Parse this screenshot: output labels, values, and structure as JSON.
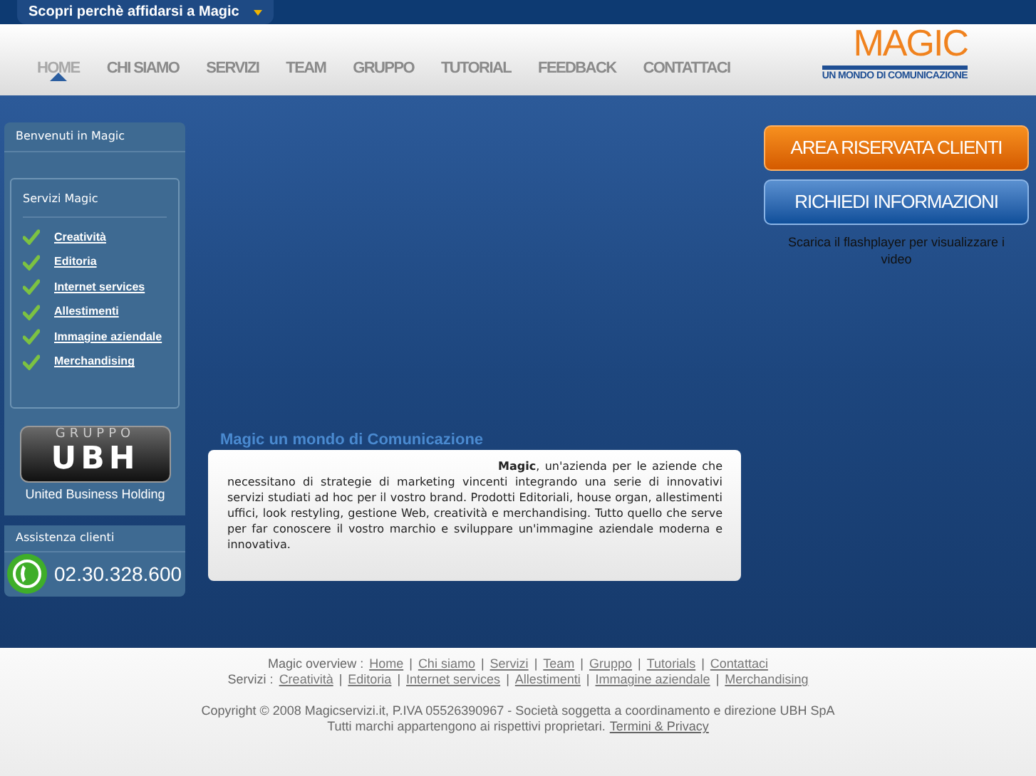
{
  "top_tab": {
    "label": "Scopri perchè affidarsi a Magic"
  },
  "nav": [
    {
      "label": "HOME",
      "selected": true
    },
    {
      "label": "CHI SIAMO",
      "selected": false
    },
    {
      "label": "SERVIZI",
      "selected": false
    },
    {
      "label": "TEAM",
      "selected": false
    },
    {
      "label": "GRUPPO",
      "selected": false
    },
    {
      "label": "TUTORIAL",
      "selected": false
    },
    {
      "label": "FEEDBACK",
      "selected": false
    },
    {
      "label": "CONTATTACI",
      "selected": false
    }
  ],
  "logo": {
    "name": "MAGIC",
    "tagline": "UN MONDO DI COMUNICAZIONE"
  },
  "sidebar": {
    "welcome": "Benvenuti in Magic",
    "services_title": "Servizi Magic",
    "services": [
      "Creatività",
      "Editoria",
      "Internet services",
      "Allestimenti",
      "Immagine aziendale",
      "Merchandising"
    ],
    "group_logo": {
      "top": "GRUPPO",
      "main": "UBH",
      "caption": "United Business Holding"
    },
    "support": {
      "title": "Assistenza clienti",
      "phone": "02.30.328.600"
    }
  },
  "intro": {
    "title": "Magic un mondo di Comunicazione",
    "text": "**Magic**, un'azienda per le aziende che necessitano di strategie di marketing vincenti integrando una serie di innovativi servizi studiati ad hoc per il vostro brand. Prodotti Editoriali, house organ, allestimenti uffici, look restyling, gestione Web, creatività e merchandising. Tutto quello che serve per far conoscere il vostro marchio e sviluppare un'immagine aziendale moderna e innovativa."
  },
  "buttons": [
    {
      "label": "AREA RISERVATA CLIENTI",
      "kind": "orange"
    },
    {
      "label": "RICHIEDI INFORMAZIONI",
      "kind": "blue"
    }
  ],
  "flash_note": "Scarica il flashplayer per visualizzare i video",
  "footer": {
    "separator": "|",
    "rows": [
      {
        "label": "Magic overview :",
        "links": [
          "Home",
          "Chi siamo",
          "Servizi",
          "Team",
          "Gruppo",
          "Tutorials",
          "Contattaci"
        ]
      },
      {
        "label": "Servizi :",
        "links": [
          "Creatività",
          "Editoria",
          "Internet services",
          "Allestimenti",
          "Immagine aziendale",
          "Merchandising"
        ]
      }
    ],
    "copyright": "Copyright © 2008 Magicservizi.it, P.IVA 05526390967 - Società soggetta a coordinamento e direzione UBH SpA",
    "rights": "Tutti marchi appartengono ai rispettivi proprietari.",
    "terms": "Termini & Privacy"
  }
}
